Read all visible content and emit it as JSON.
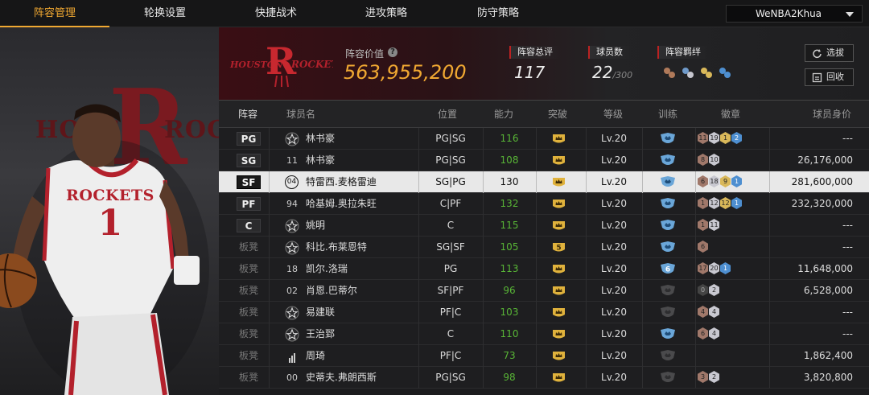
{
  "nav": {
    "tabs": [
      "阵容管理",
      "轮换设置",
      "快捷战术",
      "进攻策略",
      "防守策略"
    ],
    "active_index": 0,
    "user": "WeNBA2Khua"
  },
  "player_art": {
    "jersey": "ROCKETS",
    "jersey_number": "1",
    "bg_word_left": "HOUS",
    "bg_word_right": "ROCK",
    "bg_letter": "R"
  },
  "team": {
    "logo_text_left": "HOUSTON",
    "logo_text_right": "ROCKETS",
    "logo_letter": "R",
    "value_label": "阵容价值",
    "value": "563,955,200"
  },
  "stats": {
    "overall_label": "阵容总评",
    "overall_value": "117",
    "players_label": "球员数",
    "players_value": "22",
    "players_max": "/300",
    "bond_label": "阵容羁绊"
  },
  "buttons": {
    "scout": "选拔",
    "recycle": "回收"
  },
  "columns": [
    "阵容",
    "球员名",
    "位置",
    "能力",
    "突破",
    "等级",
    "训练",
    "徽章",
    "球员身价"
  ],
  "players": [
    {
      "slot": "PG",
      "bench": false,
      "num": "",
      "star": true,
      "name": "林书豪",
      "position": "PG|SG",
      "ovr": "116",
      "breakthrough": "crown",
      "level": "Lv.20",
      "training": "shield-blue",
      "badges": [
        [
          "bronze",
          "11"
        ],
        [
          "silver",
          "19"
        ],
        [
          "gold",
          "1"
        ],
        [
          "blue",
          "2"
        ]
      ],
      "worth": "---"
    },
    {
      "slot": "SG",
      "bench": false,
      "num": "11",
      "star": false,
      "name": "林书豪",
      "position": "PG|SG",
      "ovr": "108",
      "breakthrough": "crown",
      "level": "Lv.20",
      "training": "shield-blue",
      "badges": [
        [
          "bronze",
          "8"
        ],
        [
          "silver",
          "10"
        ]
      ],
      "worth": "26,176,000"
    },
    {
      "slot": "SF",
      "bench": false,
      "num": "04",
      "star": false,
      "name": "特雷西.麦格雷迪",
      "position": "SG|PG",
      "ovr": "130",
      "breakthrough": "crown",
      "level": "Lv.20",
      "training": "shield-blue",
      "badges": [
        [
          "bronze",
          "6"
        ],
        [
          "silver",
          "18"
        ],
        [
          "gold",
          "9"
        ],
        [
          "blue",
          "1"
        ]
      ],
      "worth": "281,600,000",
      "selected": true
    },
    {
      "slot": "PF",
      "bench": false,
      "num": "94",
      "star": false,
      "name": "哈基姆.奥拉朱旺",
      "position": "C|PF",
      "ovr": "132",
      "breakthrough": "crown",
      "level": "Lv.20",
      "training": "shield-blue",
      "badges": [
        [
          "bronze",
          "1"
        ],
        [
          "silver",
          "12"
        ],
        [
          "gold",
          "12"
        ],
        [
          "blue",
          "1"
        ]
      ],
      "worth": "232,320,000"
    },
    {
      "slot": "C",
      "bench": false,
      "num": "",
      "star": true,
      "name": "姚明",
      "position": "C",
      "ovr": "115",
      "breakthrough": "crown",
      "level": "Lv.20",
      "training": "shield-blue",
      "badges": [
        [
          "bronze",
          "1"
        ],
        [
          "silver",
          "11"
        ]
      ],
      "worth": "---"
    },
    {
      "slot": "板凳",
      "bench": true,
      "num": "",
      "star": true,
      "name": "科比.布莱恩特",
      "position": "SG|SF",
      "ovr": "105",
      "breakthrough": "5",
      "level": "Lv.20",
      "training": "shield-blue",
      "badges": [
        [
          "bronze",
          "6"
        ]
      ],
      "worth": "---"
    },
    {
      "slot": "板凳",
      "bench": true,
      "num": "18",
      "star": false,
      "name": "凯尔.洛瑞",
      "position": "PG",
      "ovr": "113",
      "breakthrough": "crown",
      "level": "Lv.20",
      "training": "6",
      "badges": [
        [
          "bronze",
          "17"
        ],
        [
          "silver",
          "20"
        ],
        [
          "blue",
          "1"
        ]
      ],
      "worth": "11,648,000"
    },
    {
      "slot": "板凳",
      "bench": true,
      "num": "02",
      "star": false,
      "name": "肖恩.巴蒂尔",
      "position": "SF|PF",
      "ovr": "96",
      "breakthrough": "crown",
      "level": "Lv.20",
      "training": "shield-dark",
      "badges": [
        [
          "dark",
          "0"
        ],
        [
          "silver",
          "2"
        ]
      ],
      "worth": "6,528,000"
    },
    {
      "slot": "板凳",
      "bench": true,
      "num": "",
      "star": true,
      "name": "易建联",
      "position": "PF|C",
      "ovr": "103",
      "breakthrough": "crown",
      "level": "Lv.20",
      "training": "shield-dark",
      "badges": [
        [
          "bronze",
          "4"
        ],
        [
          "silver",
          "4"
        ]
      ],
      "worth": "---"
    },
    {
      "slot": "板凳",
      "bench": true,
      "num": "",
      "star": true,
      "name": "王治郅",
      "position": "C",
      "ovr": "110",
      "breakthrough": "crown",
      "level": "Lv.20",
      "training": "shield-blue",
      "badges": [
        [
          "bronze",
          "6"
        ],
        [
          "silver",
          "4"
        ]
      ],
      "worth": "---"
    },
    {
      "slot": "板凳",
      "bench": true,
      "num": "bars",
      "star": false,
      "name": "周琦",
      "position": "PF|C",
      "ovr": "73",
      "breakthrough": "crown",
      "level": "Lv.20",
      "training": "shield-dark",
      "badges": [],
      "worth": "1,862,400"
    },
    {
      "slot": "板凳",
      "bench": true,
      "num": "00",
      "star": false,
      "name": "史蒂夫.弗朗西斯",
      "position": "PG|SG",
      "ovr": "98",
      "breakthrough": "crown",
      "level": "Lv.20",
      "training": "shield-dark",
      "badges": [
        [
          "bronze",
          "3"
        ],
        [
          "silver",
          "2"
        ]
      ],
      "worth": "3,820,800"
    }
  ],
  "colors": {
    "accent": "#f0a832",
    "ovr_green": "#58b536",
    "rockets_red": "#b3212c",
    "selected_row": "#e8e8e8"
  }
}
